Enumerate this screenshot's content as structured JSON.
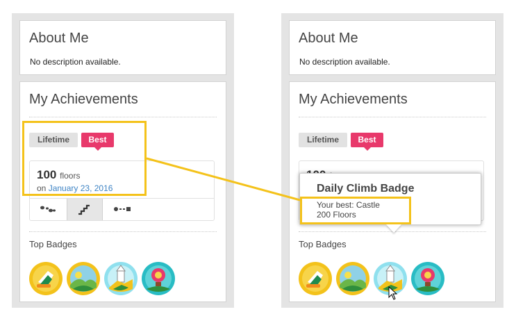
{
  "left_panel": {
    "about": {
      "title": "About Me",
      "description": "No description available."
    },
    "achievements": {
      "title": "My Achievements",
      "tabs": {
        "lifetime": "Lifetime",
        "best": "Best"
      },
      "stat": {
        "value": "100",
        "unit": "floors",
        "date_prefix": "on",
        "date": "January 23, 2016"
      },
      "top_badges_label": "Top Badges"
    }
  },
  "right_panel": {
    "about": {
      "title": "About Me",
      "description": "No description available."
    },
    "achievements": {
      "title": "My Achievements",
      "tabs": {
        "lifetime": "Lifetime",
        "best": "Best"
      },
      "stat": {
        "value": "100",
        "unit": "f"
      },
      "top_badges_label": "Top Badges"
    },
    "tooltip": {
      "title": "Daily Climb Badge",
      "line1": "Your best: Castle",
      "line2": "200 Floors"
    }
  },
  "colors": {
    "accent": "#e8396b",
    "link": "#3d83c4",
    "highlight": "#f4c21a"
  },
  "icons": [
    "footsteps-icon",
    "stairs-icon",
    "distance-icon",
    "badge-sneaker-icon",
    "badge-hills-icon",
    "badge-castle-icon",
    "badge-balloon-icon",
    "cursor-icon"
  ]
}
